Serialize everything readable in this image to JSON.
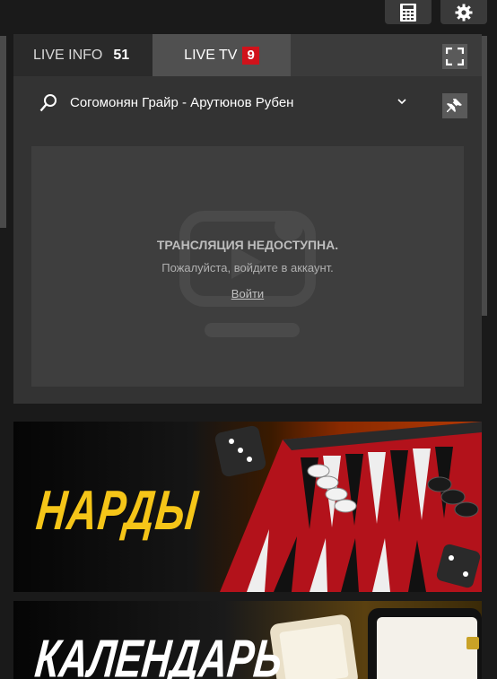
{
  "toolbar": {
    "calculator_icon": "calculator-icon",
    "settings_icon": "gear-icon"
  },
  "tabs": [
    {
      "label": "LIVE INFO",
      "count": "51"
    },
    {
      "label": "LIVE TV",
      "count": "9"
    }
  ],
  "match": {
    "name": "Согомонян Грайр - Арутюнов Рубен"
  },
  "stream": {
    "title": "ТРАНСЛЯЦИЯ НЕДОСТУПНА.",
    "message": "Пожалуйста, войдите в аккаунт.",
    "login_link": "Войти"
  },
  "banners": [
    {
      "text": "НАРДЫ"
    },
    {
      "text": "КАЛЕНДАРЬ"
    }
  ],
  "colors": {
    "accent_red": "#d0121b",
    "nardy_yellow": "#f5c518"
  }
}
